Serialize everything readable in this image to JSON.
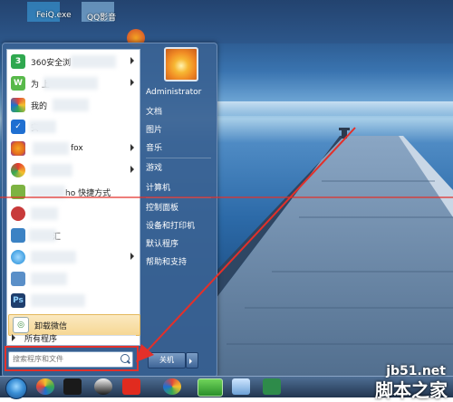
{
  "desktop": {
    "top_icons": [
      {
        "label": "FeiQ.exe",
        "color": "#3aa0e0"
      },
      {
        "label": "QQ影音",
        "color": "#8fc1e8"
      }
    ]
  },
  "start_menu": {
    "programs": [
      {
        "label": "360安全浏",
        "icon": "360-safe-icon",
        "color": "#2fa84f",
        "arrow": true
      },
      {
        "label": "为 上",
        "icon": "wechat-icon",
        "color": "#58b94a",
        "arrow": true
      },
      {
        "label": "我的",
        "icon": "browser-icon",
        "color": "#e0473a",
        "arrow": false
      },
      {
        "label": "安",
        "icon": "shield-icon",
        "color": "#1f6fd1",
        "arrow": false
      },
      {
        "label": "fox",
        "icon": "firefox-icon",
        "color": "#e36a1e",
        "arrow": true
      },
      {
        "label": "",
        "icon": "chrome-icon",
        "color": "#e5392f",
        "arrow": true
      },
      {
        "label": "ho 快捷方式",
        "icon": "app-icon",
        "color": "#7db342",
        "arrow": false
      },
      {
        "label": "",
        "icon": "game-icon",
        "color": "#c83a3a",
        "arrow": false
      },
      {
        "label": "汇",
        "icon": "tool-icon",
        "color": "#3b82c4",
        "arrow": false
      },
      {
        "label": "",
        "icon": "media-icon",
        "color": "#1e8ad6",
        "arrow": true
      },
      {
        "label": "",
        "icon": "document-icon",
        "color": "#5a8fc8",
        "arrow": false
      },
      {
        "label": "",
        "icon": "photoshop-icon",
        "color": "#1f3e6d",
        "arrow": false
      }
    ],
    "highlighted": {
      "label": "卸载微信",
      "icon": "uninstall-icon"
    },
    "all_programs_label": "所有程序",
    "search": {
      "placeholder": "搜索程序和文件"
    },
    "user": {
      "name": "Administrator"
    },
    "right_items": [
      {
        "label": "文档",
        "name": "documents"
      },
      {
        "label": "图片",
        "name": "pictures"
      },
      {
        "label": "音乐",
        "name": "music"
      },
      {
        "label": "游戏",
        "name": "games"
      },
      {
        "label": "计算机",
        "name": "computer"
      },
      {
        "label": "控制面板",
        "name": "control-panel"
      },
      {
        "label": "设备和打印机",
        "name": "devices-printers"
      },
      {
        "label": "默认程序",
        "name": "default-programs"
      },
      {
        "label": "帮助和支持",
        "name": "help-support"
      }
    ],
    "shutdown_label": "关机"
  },
  "taskbar": {
    "icons": [
      "start-orb",
      "paint-icon",
      "media-player-icon",
      "qq-icon",
      "toolbox-icon",
      "browser-icon",
      "ie-icon",
      "explorer-icon",
      "excel-icon"
    ]
  },
  "watermark": {
    "domain": "jb51.net",
    "cn": "脚本之家"
  }
}
